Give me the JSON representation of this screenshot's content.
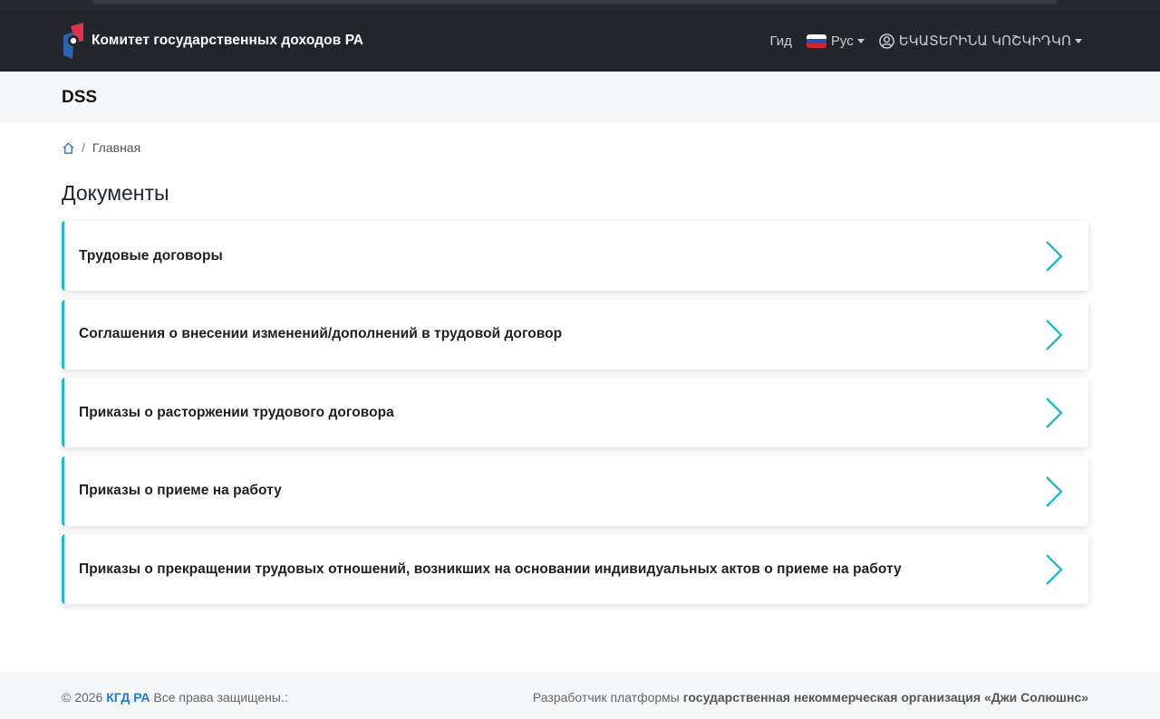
{
  "colors": {
    "navbar_bg": "#22262b",
    "accent": "#21b8cf",
    "link": "#1f7ad6"
  },
  "navbar": {
    "brand_title": "Комитет государственных доходов РА",
    "logo_icon": "kgd-logo-icon",
    "guide_label": "Гид",
    "language_label": "Рус",
    "language_flag": "russia-flag-icon",
    "user_label": "ԵԿԱՏԵՐԻՆԱ ԿՈՇԿԻԴԿՈ",
    "user_icon": "user-circle-icon"
  },
  "page_header": {
    "title": "DSS"
  },
  "breadcrumb": {
    "home_icon": "home-icon",
    "separator": "/",
    "current": "Главная"
  },
  "section": {
    "title": "Документы"
  },
  "cards": [
    {
      "label": "Трудовые договоры",
      "icon": "chevron-right-icon"
    },
    {
      "label": "Соглашения о внесении изменений/дополнений в трудовой договор",
      "icon": "chevron-right-icon"
    },
    {
      "label": "Приказы о расторжении трудового договора",
      "icon": "chevron-right-icon"
    },
    {
      "label": "Приказы о приеме на работу",
      "icon": "chevron-right-icon"
    },
    {
      "label": "Приказы о прекращении трудовых отношений, возникших на основании индивидуальных актов о приеме на работу",
      "icon": "chevron-right-icon"
    }
  ],
  "footer": {
    "copyright": "© 2026",
    "org_link": "КГД РА",
    "rights": "Все права защищены.:",
    "developer_prefix": "Разработчик платформы",
    "developer_name": "государственная некоммерческая организация «Джи Солюшнс»"
  }
}
